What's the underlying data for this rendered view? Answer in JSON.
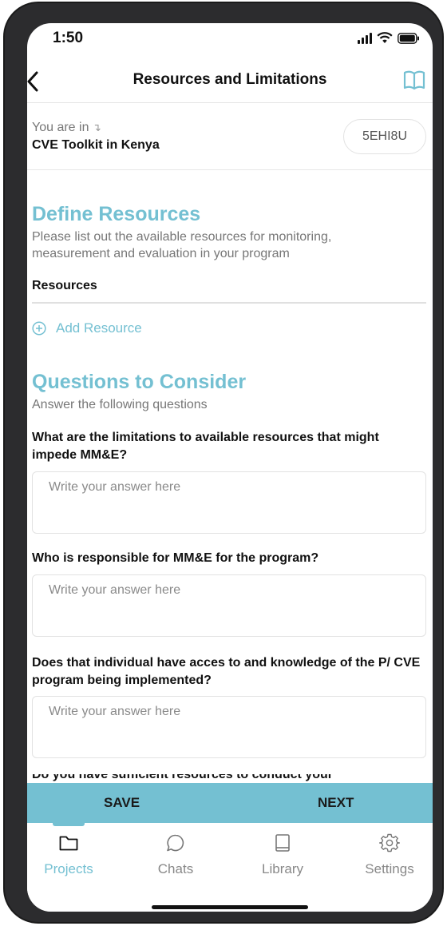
{
  "status_bar": {
    "time": "1:50"
  },
  "header": {
    "title": "Resources and Limitations"
  },
  "location": {
    "label": "You are in",
    "name": "CVE Toolkit in Kenya",
    "code": "5EHI8U"
  },
  "define_resources": {
    "title": "Define Resources",
    "description": "Please list out the available resources for monitoring, measurement and evaluation in your program",
    "list_label": "Resources",
    "add_label": "Add Resource"
  },
  "questions": {
    "title": "Questions to Consider",
    "subtitle": "Answer the following questions",
    "placeholder": "Write your answer here",
    "items": [
      {
        "text": "What are the limitations to available resources that might impede MM&E?"
      },
      {
        "text": "Who is responsible for MM&E for the program?"
      },
      {
        "text": "Does that individual have acces to and knowledge of the P/ CVE program being implemented?"
      },
      {
        "text": "Do you have sufficient resources to conduct your"
      }
    ]
  },
  "actions": {
    "save": "SAVE",
    "next": "NEXT"
  },
  "tabs": [
    {
      "label": "Projects",
      "icon": "folder-icon",
      "active": true
    },
    {
      "label": "Chats",
      "icon": "chat-bubble-icon",
      "active": false
    },
    {
      "label": "Library",
      "icon": "book-icon",
      "active": false
    },
    {
      "label": "Settings",
      "icon": "gear-icon",
      "active": false
    }
  ],
  "colors": {
    "accent": "#74c0d2",
    "text": "#111111",
    "muted": "#777777"
  }
}
